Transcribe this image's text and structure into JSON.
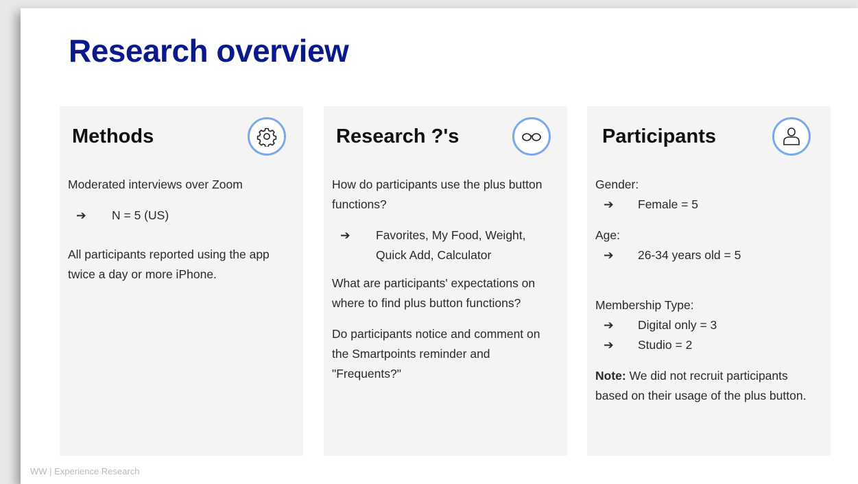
{
  "title": "Research overview",
  "methods": {
    "heading": "Methods",
    "icon": "gear-icon",
    "intro": "Moderated interviews over Zoom",
    "bullet": "N = 5 (US)",
    "note": "All participants reported using the app twice a day or more iPhone."
  },
  "questions": {
    "heading": "Research ?'s",
    "icon": "glasses-icon",
    "q1": "How do participants use the plus button functions?",
    "q1_bullet": "Favorites, My Food, Weight, Quick Add, Calculator",
    "q2": "What are participants' expectations on where to find plus button functions?",
    "q3": "Do participants notice and comment on the Smartpoints reminder and \"Frequents?\""
  },
  "participants": {
    "heading": "Participants",
    "icon": "user-icon",
    "gender_label": "Gender:",
    "gender_value": "Female = 5",
    "age_label": "Age:",
    "age_value": "26-34 years old = 5",
    "membership_label": "Membership Type:",
    "membership_values": [
      "Digital only = 3",
      "Studio = 2"
    ],
    "note_label": "Note:",
    "note_text": " We did not recruit participants based on their usage of the plus button."
  },
  "arrow": "➔",
  "footer": "WW | Experience Research",
  "colors": {
    "title": "#0a1a8a",
    "card_bg": "#f4f4f5",
    "icon_ring": "#7aa8e8"
  }
}
